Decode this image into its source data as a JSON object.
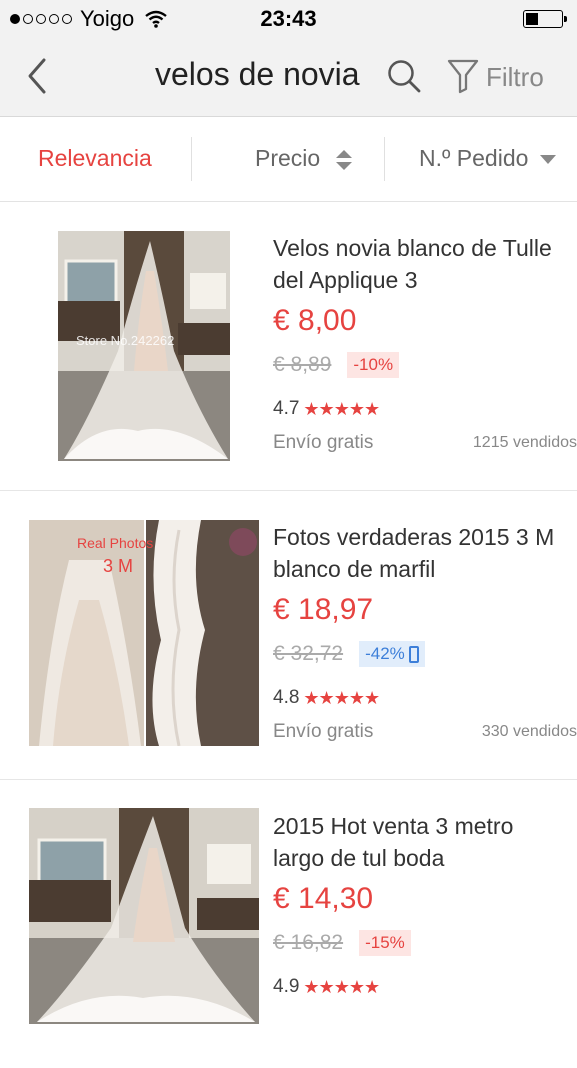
{
  "status_bar": {
    "signal": "●○○○○",
    "carrier": "Yoigo",
    "time": "23:43"
  },
  "header": {
    "title": "velos de novia",
    "filter_label": "Filtro"
  },
  "sort": {
    "relevance": "Relevancia",
    "price": "Precio",
    "orders": "N.º Pedido"
  },
  "colors": {
    "accent": "#e64340",
    "mobile_badge": "#3d7fd9"
  },
  "products": [
    {
      "title": "Velos novia blanco de Tulle del Applique 3",
      "price": "€ 8,00",
      "old_price": "€ 8,89",
      "discount": "-10%",
      "rating": "4.7",
      "stars": "★★★★★",
      "shipping": "Envío gratis",
      "sold": "1215 vendidos",
      "image_text": "Store No.242262"
    },
    {
      "title": "Fotos verdaderas 2015 3 M blanco  de marfil",
      "price": "€ 18,97",
      "old_price": "€ 32,72",
      "discount": "-42%",
      "rating": "4.8",
      "stars": "★★★★★",
      "shipping": "Envío gratis",
      "sold": "330 vendidos",
      "image_text_1": "Real Photos",
      "image_text_2": "3 M"
    },
    {
      "title": "2015 Hot venta 3 metro largo de tul boda",
      "price": "€ 14,30",
      "old_price": "€ 16,82",
      "discount": "-15%",
      "rating": "4.9",
      "stars": "★★★★★"
    }
  ]
}
